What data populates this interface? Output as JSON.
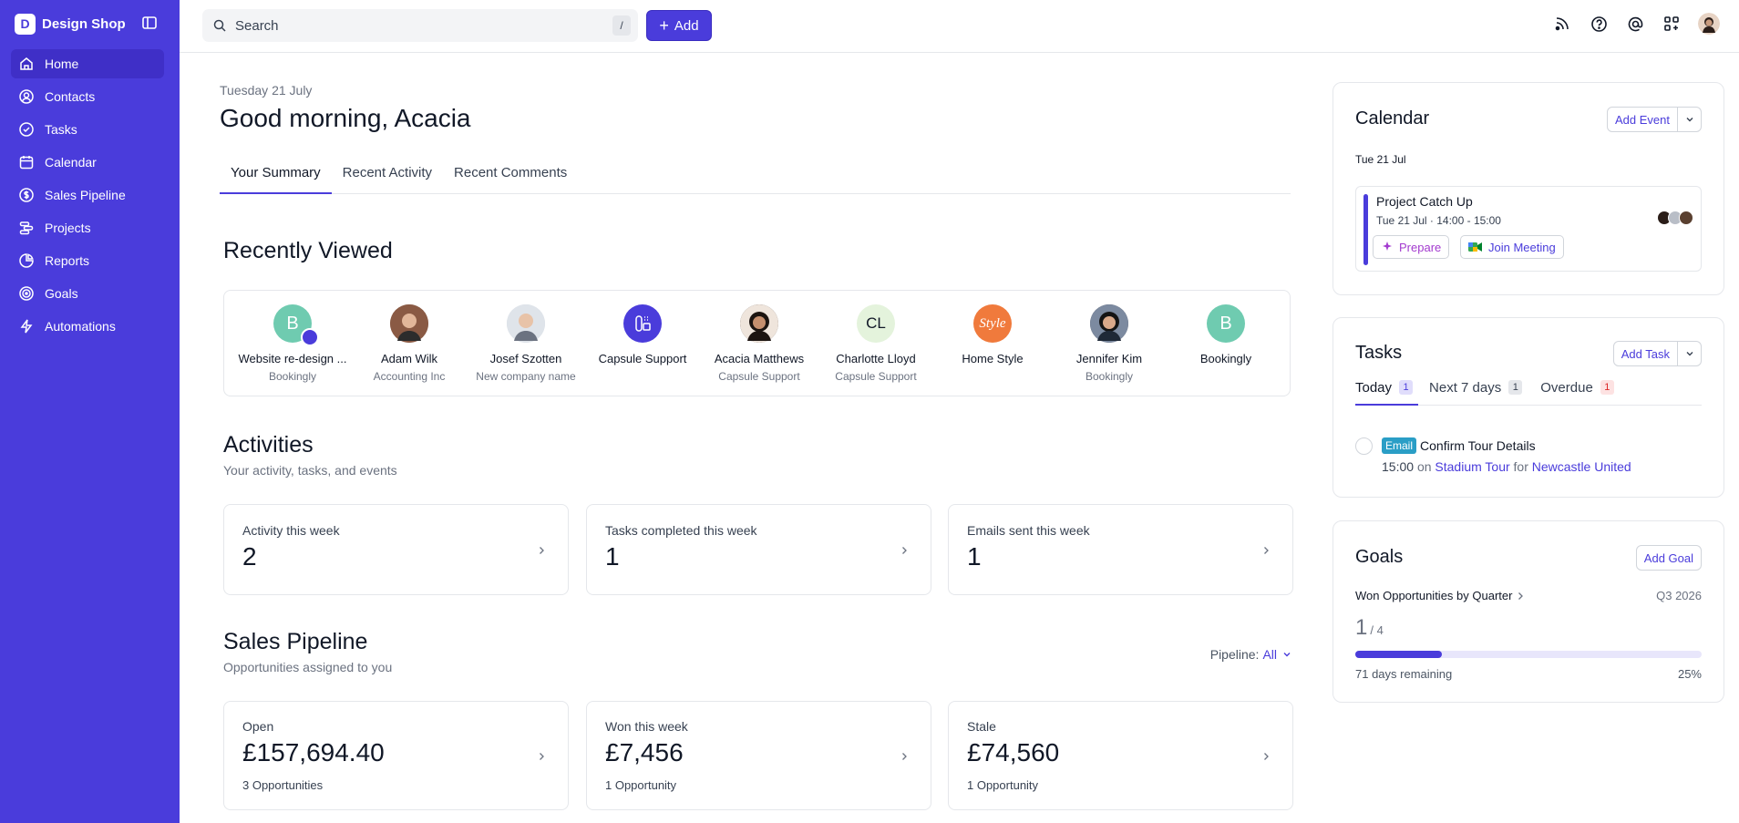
{
  "brand": {
    "logo_letter": "D",
    "name": "Design Shop"
  },
  "sidebar": {
    "items": [
      {
        "label": "Home",
        "icon": "home-icon",
        "active": true
      },
      {
        "label": "Contacts",
        "icon": "contact-icon"
      },
      {
        "label": "Tasks",
        "icon": "check-circle-icon"
      },
      {
        "label": "Calendar",
        "icon": "calendar-icon"
      },
      {
        "label": "Sales Pipeline",
        "icon": "dollar-icon"
      },
      {
        "label": "Projects",
        "icon": "projects-icon"
      },
      {
        "label": "Reports",
        "icon": "pie-chart-icon"
      },
      {
        "label": "Goals",
        "icon": "target-icon"
      },
      {
        "label": "Automations",
        "icon": "bolt-icon"
      }
    ]
  },
  "topbar": {
    "search_placeholder": "Search",
    "search_shortcut": "/",
    "add_label": "Add"
  },
  "main": {
    "date": "Tuesday 21 July",
    "greeting": "Good morning, Acacia",
    "tabs": [
      "Your Summary",
      "Recent Activity",
      "Recent Comments"
    ],
    "recently_viewed": {
      "title": "Recently Viewed",
      "items": [
        {
          "initial": "B",
          "color": "#6fcbb0",
          "name": "Website re-design ...",
          "sub": "Bookingly"
        },
        {
          "initial": "",
          "color": "#8a5a44",
          "name": "Adam Wilk",
          "sub": "Accounting Inc"
        },
        {
          "initial": "",
          "color": "#c9d0db",
          "name": "Josef Szotten",
          "sub": "New company name"
        },
        {
          "initial": "",
          "color": "#4a3cdb",
          "name": "Capsule Support",
          "sub": ""
        },
        {
          "initial": "",
          "color": "#3b2a24",
          "name": "Acacia Matthews",
          "sub": "Capsule Support"
        },
        {
          "initial": "CL",
          "color": "#e4f3dc",
          "name": "Charlotte Lloyd",
          "sub": "Capsule Support"
        },
        {
          "initial": "Style",
          "color": "#f07a3c",
          "name": "Home Style",
          "sub": ""
        },
        {
          "initial": "",
          "color": "#2b2b3a",
          "name": "Jennifer Kim",
          "sub": "Bookingly"
        },
        {
          "initial": "B",
          "color": "#6fcbb0",
          "name": "Bookingly",
          "sub": ""
        }
      ]
    },
    "activities": {
      "title": "Activities",
      "subtitle": "Your activity, tasks, and events",
      "cards": [
        {
          "label": "Activity this week",
          "value": "2"
        },
        {
          "label": "Tasks completed this week",
          "value": "1"
        },
        {
          "label": "Emails sent this week",
          "value": "1"
        }
      ]
    },
    "pipeline": {
      "title": "Sales Pipeline",
      "subtitle": "Opportunities assigned to you",
      "filter_label": "Pipeline:",
      "filter_value": "All",
      "cards": [
        {
          "label": "Open",
          "value": "£157,694.40",
          "sub": "3 Opportunities"
        },
        {
          "label": "Won this week",
          "value": "£7,456",
          "sub": "1 Opportunity"
        },
        {
          "label": "Stale",
          "value": "£74,560",
          "sub": "1 Opportunity"
        }
      ]
    }
  },
  "calendar": {
    "title": "Calendar",
    "add_label": "Add Event",
    "day": "Tue 21 Jul",
    "event": {
      "title": "Project Catch Up",
      "time": "Tue 21 Jul · 14:00 - 15:00",
      "prepare_label": "Prepare",
      "join_label": "Join Meeting"
    }
  },
  "tasks": {
    "title": "Tasks",
    "add_label": "Add Task",
    "tabs": [
      {
        "label": "Today",
        "count": "1"
      },
      {
        "label": "Next 7 days",
        "count": "1"
      },
      {
        "label": "Overdue",
        "count": "1"
      }
    ],
    "item": {
      "tag": "Email",
      "title": "Confirm Tour Details",
      "time": "15:00",
      "on_word": "on",
      "project": "Stadium Tour",
      "for_word": "for",
      "org": "Newcastle United"
    }
  },
  "goals": {
    "title": "Goals",
    "add_label": "Add Goal",
    "goal_name": "Won Opportunities by Quarter",
    "quarter": "Q3 2026",
    "current": "1",
    "target": "/ 4",
    "remaining": "71 days remaining",
    "percent_label": "25%",
    "progress": 0.25
  },
  "colors": {
    "accent": "#4a3cdb",
    "teal": "#6fcbb0",
    "red": "#dc2626"
  }
}
